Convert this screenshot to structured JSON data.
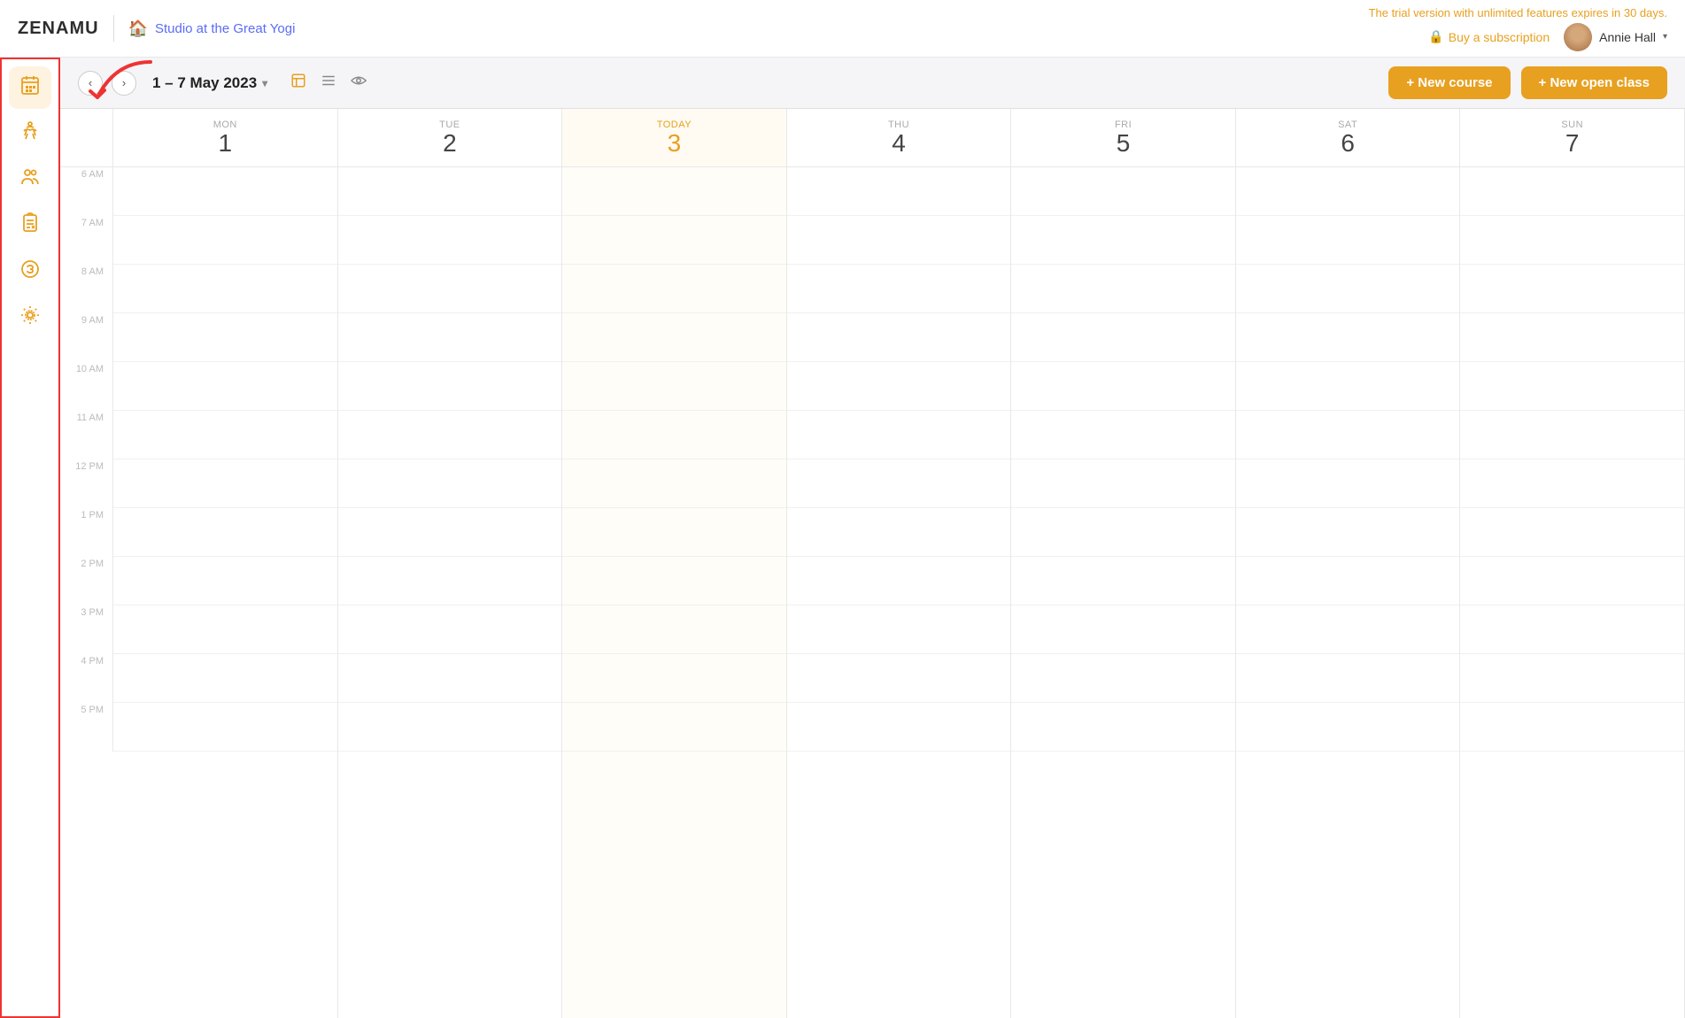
{
  "app": {
    "logo": "ZENAMU",
    "studio_name": "Studio at the Great Yogi"
  },
  "header": {
    "trial_text": "The trial version with unlimited features expires in 30 days.",
    "buy_subscription_label": "Buy a subscription",
    "user_name": "Annie Hall"
  },
  "toolbar": {
    "date_range": "1 – 7 May 2023",
    "new_course_label": "+ New course",
    "new_open_class_label": "+ New open class"
  },
  "sidebar": {
    "items": [
      {
        "id": "calendar",
        "icon": "📅",
        "label": "Calendar"
      },
      {
        "id": "classes",
        "icon": "🧘",
        "label": "Classes"
      },
      {
        "id": "members",
        "icon": "👥",
        "label": "Members"
      },
      {
        "id": "reports",
        "icon": "📋",
        "label": "Reports"
      },
      {
        "id": "payments",
        "icon": "💰",
        "label": "Payments"
      },
      {
        "id": "settings",
        "icon": "⚙",
        "label": "Settings"
      }
    ]
  },
  "calendar": {
    "days": [
      {
        "label": "MON",
        "number": "1",
        "today": false
      },
      {
        "label": "TUE",
        "number": "2",
        "today": false
      },
      {
        "label": "TODAY",
        "number": "3",
        "today": true
      },
      {
        "label": "THU",
        "number": "4",
        "today": false
      },
      {
        "label": "FRI",
        "number": "5",
        "today": false
      },
      {
        "label": "SAT",
        "number": "6",
        "today": false
      },
      {
        "label": "SUN",
        "number": "7",
        "today": false
      }
    ],
    "time_slots": [
      "6 AM",
      "7 AM",
      "8 AM",
      "9 AM",
      "10 AM",
      "11 AM",
      "12 PM",
      "1 PM",
      "2 PM",
      "3 PM",
      "4 PM",
      "5 PM"
    ]
  },
  "colors": {
    "accent": "#e8a020",
    "today_bg": "#fffbf2",
    "sidebar_highlight": "#e33"
  }
}
